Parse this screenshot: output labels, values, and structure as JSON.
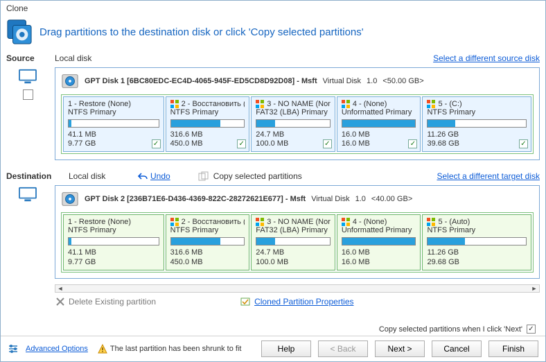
{
  "window": {
    "title": "Clone"
  },
  "header": {
    "text": "Drag partitions to the destination disk or click 'Copy selected partitions'"
  },
  "source": {
    "label": "Source",
    "sub": "Local disk",
    "select_link": "Select a different source disk",
    "disk_info_a": "GPT Disk 1 [6BC80EDC-EC4D-4065-945F-ED5CD8D92D08] - Msft",
    "disk_info_b": "Virtual Disk",
    "disk_info_c": "1.0",
    "disk_info_d": "<50.00 GB>",
    "partitions": [
      {
        "num": "1",
        "name": "Restore",
        "vol": "(None)",
        "fs": "NTFS Primary",
        "used": "41.1 MB",
        "total": "9.77 GB",
        "fill": 3,
        "flag": false
      },
      {
        "num": "2",
        "name": "Восстановить",
        "vol": "(Non",
        "fs": "NTFS Primary",
        "used": "316.6 MB",
        "total": "450.0 MB",
        "fill": 68,
        "flag": true
      },
      {
        "num": "3",
        "name": "NO NAME",
        "vol": "(Non",
        "fs": "FAT32 (LBA) Primary",
        "used": "24.7 MB",
        "total": "100.0 MB",
        "fill": 25,
        "flag": true
      },
      {
        "num": "4",
        "name": "",
        "vol": "(None)",
        "fs": "Unformatted Primary",
        "used": "16.0 MB",
        "total": "16.0 MB",
        "fill": 100,
        "flag": true
      },
      {
        "num": "5",
        "name": "",
        "vol": "(C:)",
        "fs": "NTFS Primary",
        "used": "11.26 GB",
        "total": "39.68 GB",
        "fill": 28,
        "flag": true
      }
    ]
  },
  "dest": {
    "label": "Destination",
    "sub": "Local disk",
    "undo": "Undo",
    "copy_sel": "Copy selected partitions",
    "select_link": "Select a different target disk",
    "disk_info_a": "GPT Disk 2 [236B71E6-D436-4369-822C-28272621E677] - Msft",
    "disk_info_b": "Virtual Disk",
    "disk_info_c": "1.0",
    "disk_info_d": "<40.00 GB>",
    "partitions": [
      {
        "num": "1",
        "name": "Restore",
        "vol": "(None)",
        "fs": "NTFS Primary",
        "used": "41.1 MB",
        "total": "9.77 GB",
        "fill": 3,
        "flag": false
      },
      {
        "num": "2",
        "name": "Восстановить",
        "vol": "(Nor",
        "fs": "NTFS Primary",
        "used": "316.6 MB",
        "total": "450.0 MB",
        "fill": 68,
        "flag": true
      },
      {
        "num": "3",
        "name": "NO NAME",
        "vol": "(Nor",
        "fs": "FAT32 (LBA) Primary",
        "used": "24.7 MB",
        "total": "100.0 MB",
        "fill": 25,
        "flag": true
      },
      {
        "num": "4",
        "name": "",
        "vol": "(None)",
        "fs": "Unformatted Primary",
        "used": "16.0 MB",
        "total": "16.0 MB",
        "fill": 100,
        "flag": true
      },
      {
        "num": "5",
        "name": "",
        "vol": "(Auto)",
        "fs": "NTFS Primary",
        "used": "11.26 GB",
        "total": "29.68 GB",
        "fill": 38,
        "flag": true
      }
    ]
  },
  "controls": {
    "delete_partition": "Delete Existing partition",
    "cloned_props": "Cloned Partition Properties",
    "copy_when_next": "Copy selected partitions when I click 'Next'"
  },
  "footer": {
    "advanced": "Advanced Options",
    "status": "The last partition has been shrunk to fit",
    "help": "Help",
    "back": "< Back",
    "next": "Next >",
    "cancel": "Cancel",
    "finish": "Finish"
  }
}
